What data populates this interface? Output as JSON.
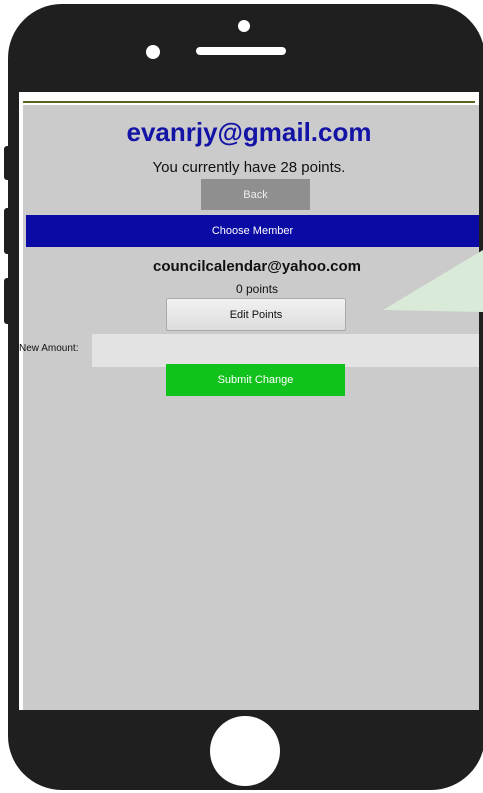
{
  "header": {
    "user_email": "evanrjy@gmail.com",
    "points_text": "You currently have 28 points."
  },
  "buttons": {
    "back": "Back",
    "choose_member": "Choose Member",
    "edit_points": "Edit Points",
    "submit_change": "Submit Change"
  },
  "member": {
    "email": "councilcalendar@yahoo.com",
    "points": "0 points"
  },
  "form": {
    "new_amount_label": "New Amount:",
    "new_amount_value": ""
  },
  "colors": {
    "title": "#1313a6",
    "choose_bar": "#0a0aa4",
    "submit": "#11c21c",
    "back_button": "#8f8f8f",
    "screen_bg": "#cbcbcb",
    "callout": "#d9ead9"
  }
}
